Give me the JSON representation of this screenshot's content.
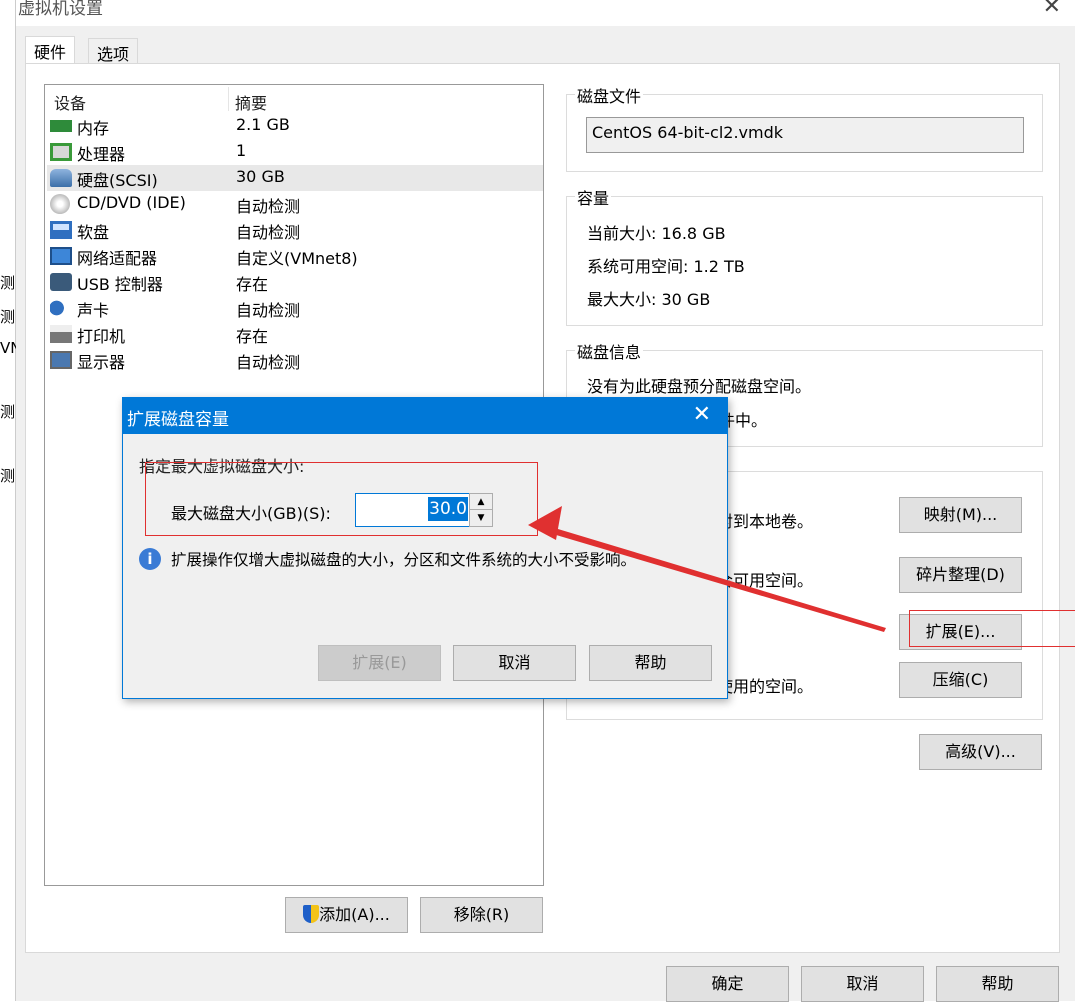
{
  "background_fragments": [
    "测",
    "测",
    "VN",
    "测",
    "测"
  ],
  "window": {
    "title": "虚拟机设置",
    "close_icon": "close-icon"
  },
  "tabs": [
    {
      "label": "硬件",
      "active": true
    },
    {
      "label": "选项",
      "active": false
    }
  ],
  "device_list": {
    "headers": {
      "device": "设备",
      "summary": "摘要"
    },
    "rows": [
      {
        "icon": "memory-icon",
        "name": "内存",
        "summary": "2.1 GB"
      },
      {
        "icon": "processor-icon",
        "name": "处理器",
        "summary": "1"
      },
      {
        "icon": "hard-disk-icon",
        "name": "硬盘(SCSI)",
        "summary": "30 GB",
        "selected": true
      },
      {
        "icon": "cd-dvd-icon",
        "name": "CD/DVD (IDE)",
        "summary": "自动检测"
      },
      {
        "icon": "floppy-icon",
        "name": "软盘",
        "summary": "自动检测"
      },
      {
        "icon": "network-adapter-icon",
        "name": "网络适配器",
        "summary": "自定义(VMnet8)"
      },
      {
        "icon": "usb-icon",
        "name": "USB 控制器",
        "summary": "存在"
      },
      {
        "icon": "sound-card-icon",
        "name": "声卡",
        "summary": "自动检测"
      },
      {
        "icon": "printer-icon",
        "name": "打印机",
        "summary": "存在"
      },
      {
        "icon": "display-icon",
        "name": "显示器",
        "summary": "自动检测"
      }
    ],
    "add_label": "添加(A)...",
    "remove_label": "移除(R)"
  },
  "disk_file": {
    "label": "磁盘文件",
    "value": "CentOS 64-bit-cl2.vmdk"
  },
  "capacity": {
    "label": "容量",
    "current": "当前大小: 16.8 GB",
    "available": "系统可用空间: 1.2 TB",
    "max": "最大大小: 30 GB"
  },
  "disk_info": {
    "label": "磁盘信息",
    "line1": "没有为此硬盘预分配磁盘空间。",
    "line2": "个文件中。"
  },
  "utilities": {
    "map_text": "射到本地卷。",
    "map_label": "映射(M)...",
    "defrag_text": "合可用空间。",
    "defrag_label": "碎片整理(D)",
    "expand_label": "扩展(E)...",
    "compact_text": "使用的空间。",
    "compact_label": "压缩(C)"
  },
  "advanced_label": "高级(V)...",
  "footer": {
    "ok": "确定",
    "cancel": "取消",
    "help": "帮助"
  },
  "dialog": {
    "title": "扩展磁盘容量",
    "prompt": "指定最大虚拟磁盘大小:",
    "field_label": "最大磁盘大小(GB)(S):",
    "field_value": "30.0",
    "info": "扩展操作仅增大虚拟磁盘的大小，分区和文件系统的大小不受影响。",
    "expand": "扩展(E)",
    "cancel": "取消",
    "help": "帮助"
  },
  "colors": {
    "accent": "#0078d7",
    "annotation": "#e03030"
  }
}
